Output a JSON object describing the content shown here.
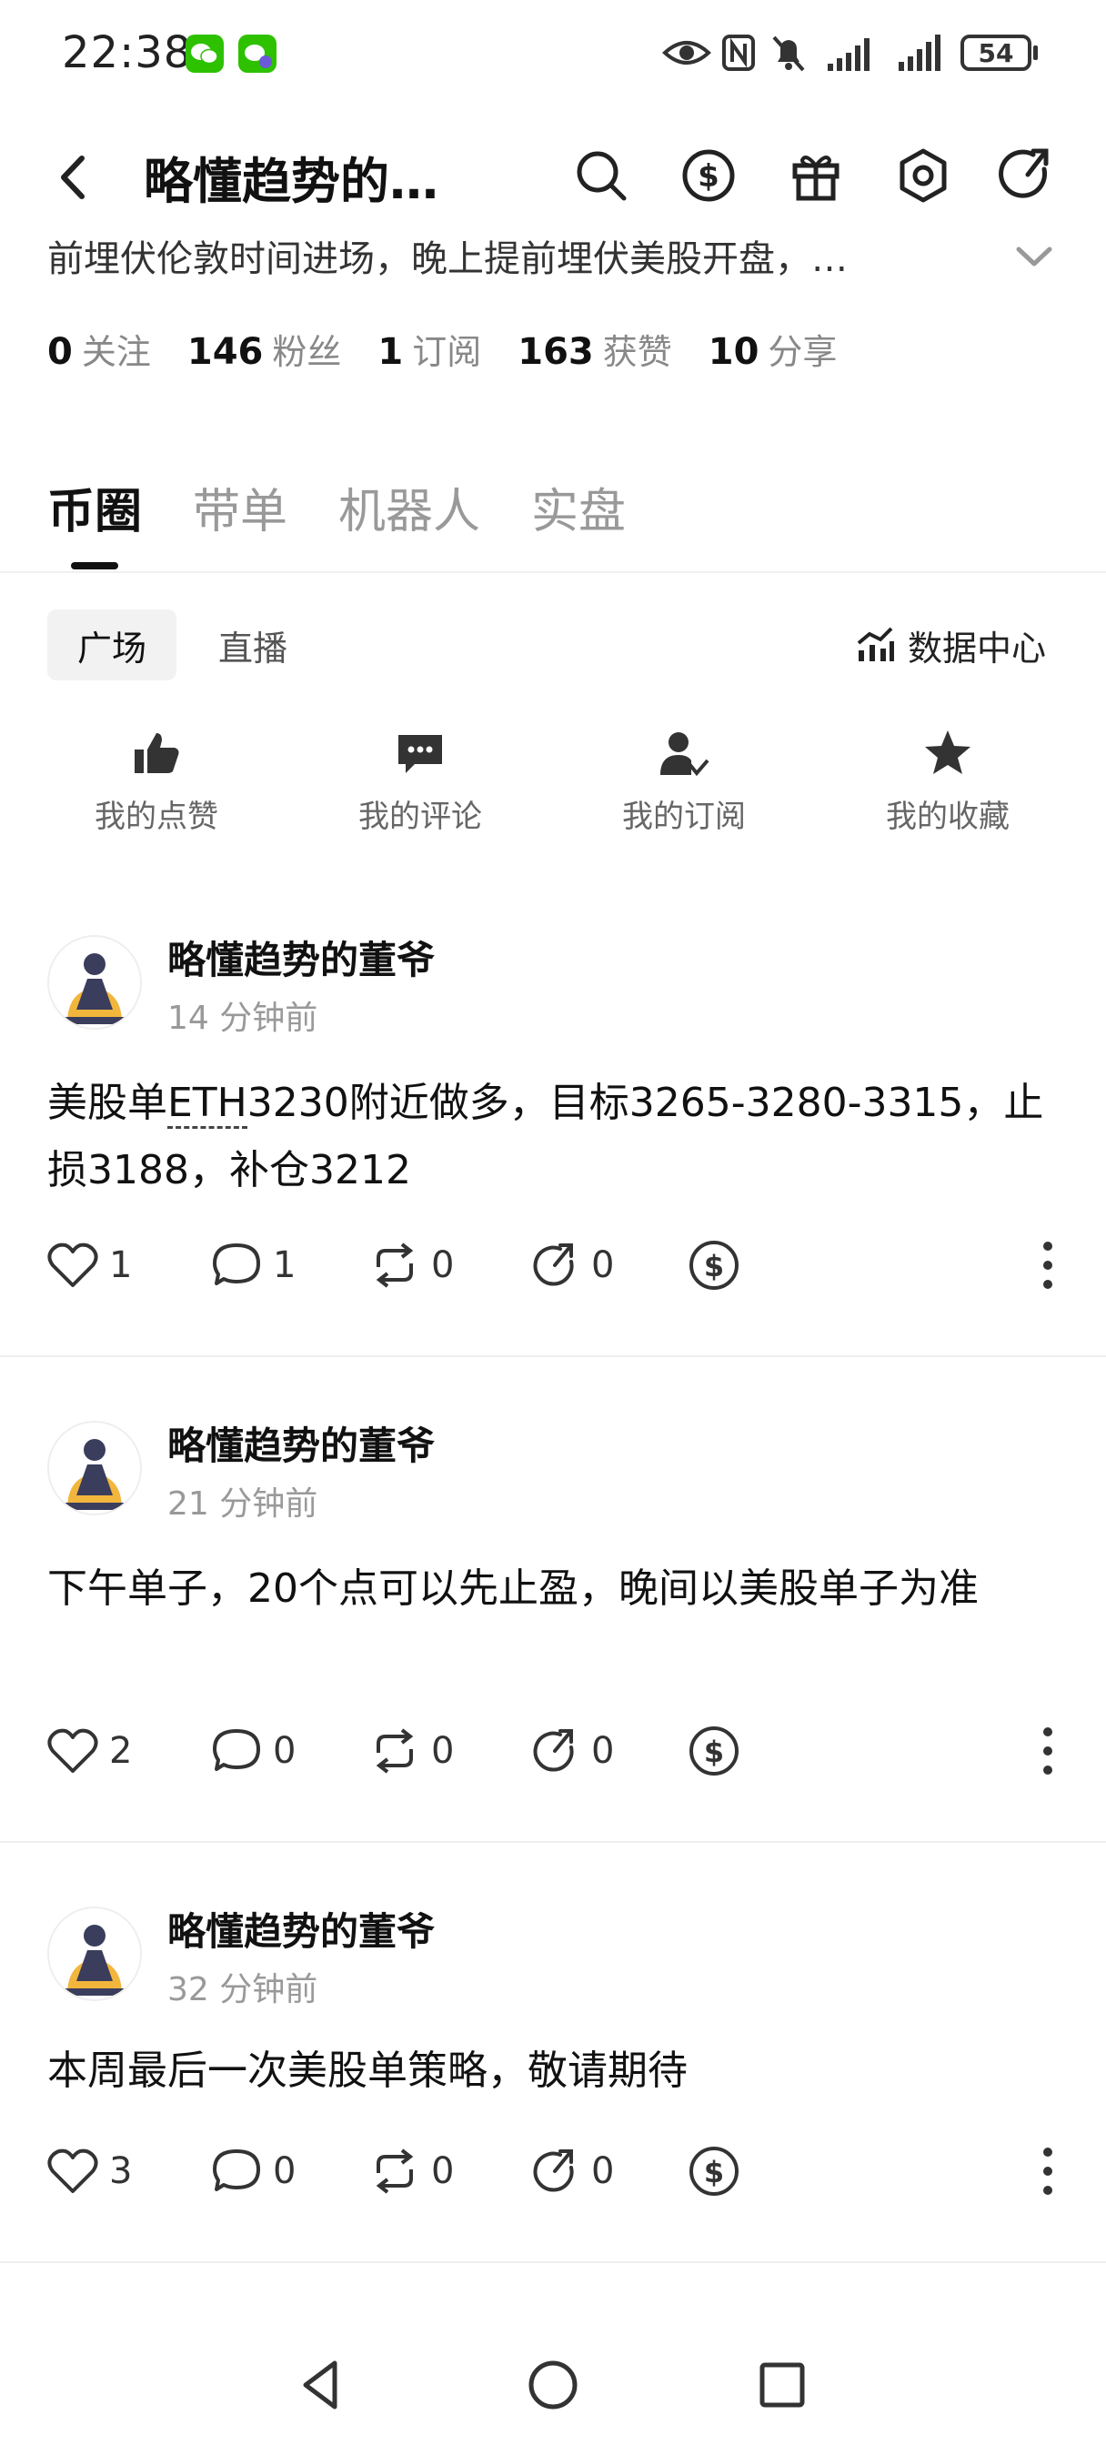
{
  "status_bar": {
    "time": "22:38",
    "battery": "54"
  },
  "header": {
    "title": "略懂趋势的…",
    "bio": "前埋伏伦敦时间进场，晚上提前埋伏美股开盘，…"
  },
  "stats": [
    {
      "num": "0",
      "label": "关注"
    },
    {
      "num": "146",
      "label": "粉丝"
    },
    {
      "num": "1",
      "label": "订阅"
    },
    {
      "num": "163",
      "label": "获赞"
    },
    {
      "num": "10",
      "label": "分享"
    }
  ],
  "tabs": [
    "币圈",
    "带单",
    "机器人",
    "实盘"
  ],
  "sub_tabs": {
    "plaza": "广场",
    "live": "直播",
    "data_center": "数据中心"
  },
  "quick_actions": [
    "我的点赞",
    "我的评论",
    "我的订阅",
    "我的收藏"
  ],
  "posts": [
    {
      "author": "略懂趋势的董爷",
      "time": "14 分钟前",
      "content_pre": "美股单",
      "content_link": "ETH",
      "content_post": "3230附近做多，目标3265-3280-3315，止损3188，补仓3212",
      "likes": "1",
      "comments": "1",
      "reposts": "0",
      "shares": "0"
    },
    {
      "author": "略懂趋势的董爷",
      "time": "21 分钟前",
      "content": "下午单子，20个点可以先止盈，晚间以美股单子为准",
      "likes": "2",
      "comments": "0",
      "reposts": "0",
      "shares": "0"
    },
    {
      "author": "略懂趋势的董爷",
      "time": "32 分钟前",
      "content": "本周最后一次美股单策略，敬请期待",
      "likes": "3",
      "comments": "0",
      "reposts": "0",
      "shares": "0"
    }
  ],
  "icons": {
    "header": [
      "search-icon",
      "tip-dollar-icon",
      "gift-icon",
      "settings-icon",
      "share-icon"
    ],
    "post_actions": [
      "heart-icon",
      "comment-icon",
      "repost-icon",
      "share-icon",
      "tip-dollar-icon",
      "more-icon"
    ],
    "nav": [
      "back-triangle-icon",
      "home-circle-icon",
      "recents-square-icon"
    ]
  }
}
